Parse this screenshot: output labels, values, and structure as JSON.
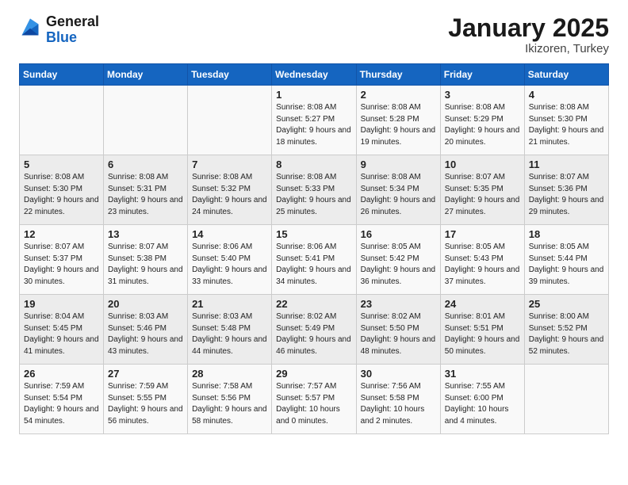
{
  "logo": {
    "general": "General",
    "blue": "Blue"
  },
  "title": "January 2025",
  "location": "Ikizoren, Turkey",
  "weekdays": [
    "Sunday",
    "Monday",
    "Tuesday",
    "Wednesday",
    "Thursday",
    "Friday",
    "Saturday"
  ],
  "weeks": [
    [
      {
        "day": "",
        "sunrise": "",
        "sunset": "",
        "daylight": ""
      },
      {
        "day": "",
        "sunrise": "",
        "sunset": "",
        "daylight": ""
      },
      {
        "day": "",
        "sunrise": "",
        "sunset": "",
        "daylight": ""
      },
      {
        "day": "1",
        "sunrise": "Sunrise: 8:08 AM",
        "sunset": "Sunset: 5:27 PM",
        "daylight": "Daylight: 9 hours and 18 minutes."
      },
      {
        "day": "2",
        "sunrise": "Sunrise: 8:08 AM",
        "sunset": "Sunset: 5:28 PM",
        "daylight": "Daylight: 9 hours and 19 minutes."
      },
      {
        "day": "3",
        "sunrise": "Sunrise: 8:08 AM",
        "sunset": "Sunset: 5:29 PM",
        "daylight": "Daylight: 9 hours and 20 minutes."
      },
      {
        "day": "4",
        "sunrise": "Sunrise: 8:08 AM",
        "sunset": "Sunset: 5:30 PM",
        "daylight": "Daylight: 9 hours and 21 minutes."
      }
    ],
    [
      {
        "day": "5",
        "sunrise": "Sunrise: 8:08 AM",
        "sunset": "Sunset: 5:30 PM",
        "daylight": "Daylight: 9 hours and 22 minutes."
      },
      {
        "day": "6",
        "sunrise": "Sunrise: 8:08 AM",
        "sunset": "Sunset: 5:31 PM",
        "daylight": "Daylight: 9 hours and 23 minutes."
      },
      {
        "day": "7",
        "sunrise": "Sunrise: 8:08 AM",
        "sunset": "Sunset: 5:32 PM",
        "daylight": "Daylight: 9 hours and 24 minutes."
      },
      {
        "day": "8",
        "sunrise": "Sunrise: 8:08 AM",
        "sunset": "Sunset: 5:33 PM",
        "daylight": "Daylight: 9 hours and 25 minutes."
      },
      {
        "day": "9",
        "sunrise": "Sunrise: 8:08 AM",
        "sunset": "Sunset: 5:34 PM",
        "daylight": "Daylight: 9 hours and 26 minutes."
      },
      {
        "day": "10",
        "sunrise": "Sunrise: 8:07 AM",
        "sunset": "Sunset: 5:35 PM",
        "daylight": "Daylight: 9 hours and 27 minutes."
      },
      {
        "day": "11",
        "sunrise": "Sunrise: 8:07 AM",
        "sunset": "Sunset: 5:36 PM",
        "daylight": "Daylight: 9 hours and 29 minutes."
      }
    ],
    [
      {
        "day": "12",
        "sunrise": "Sunrise: 8:07 AM",
        "sunset": "Sunset: 5:37 PM",
        "daylight": "Daylight: 9 hours and 30 minutes."
      },
      {
        "day": "13",
        "sunrise": "Sunrise: 8:07 AM",
        "sunset": "Sunset: 5:38 PM",
        "daylight": "Daylight: 9 hours and 31 minutes."
      },
      {
        "day": "14",
        "sunrise": "Sunrise: 8:06 AM",
        "sunset": "Sunset: 5:40 PM",
        "daylight": "Daylight: 9 hours and 33 minutes."
      },
      {
        "day": "15",
        "sunrise": "Sunrise: 8:06 AM",
        "sunset": "Sunset: 5:41 PM",
        "daylight": "Daylight: 9 hours and 34 minutes."
      },
      {
        "day": "16",
        "sunrise": "Sunrise: 8:05 AM",
        "sunset": "Sunset: 5:42 PM",
        "daylight": "Daylight: 9 hours and 36 minutes."
      },
      {
        "day": "17",
        "sunrise": "Sunrise: 8:05 AM",
        "sunset": "Sunset: 5:43 PM",
        "daylight": "Daylight: 9 hours and 37 minutes."
      },
      {
        "day": "18",
        "sunrise": "Sunrise: 8:05 AM",
        "sunset": "Sunset: 5:44 PM",
        "daylight": "Daylight: 9 hours and 39 minutes."
      }
    ],
    [
      {
        "day": "19",
        "sunrise": "Sunrise: 8:04 AM",
        "sunset": "Sunset: 5:45 PM",
        "daylight": "Daylight: 9 hours and 41 minutes."
      },
      {
        "day": "20",
        "sunrise": "Sunrise: 8:03 AM",
        "sunset": "Sunset: 5:46 PM",
        "daylight": "Daylight: 9 hours and 43 minutes."
      },
      {
        "day": "21",
        "sunrise": "Sunrise: 8:03 AM",
        "sunset": "Sunset: 5:48 PM",
        "daylight": "Daylight: 9 hours and 44 minutes."
      },
      {
        "day": "22",
        "sunrise": "Sunrise: 8:02 AM",
        "sunset": "Sunset: 5:49 PM",
        "daylight": "Daylight: 9 hours and 46 minutes."
      },
      {
        "day": "23",
        "sunrise": "Sunrise: 8:02 AM",
        "sunset": "Sunset: 5:50 PM",
        "daylight": "Daylight: 9 hours and 48 minutes."
      },
      {
        "day": "24",
        "sunrise": "Sunrise: 8:01 AM",
        "sunset": "Sunset: 5:51 PM",
        "daylight": "Daylight: 9 hours and 50 minutes."
      },
      {
        "day": "25",
        "sunrise": "Sunrise: 8:00 AM",
        "sunset": "Sunset: 5:52 PM",
        "daylight": "Daylight: 9 hours and 52 minutes."
      }
    ],
    [
      {
        "day": "26",
        "sunrise": "Sunrise: 7:59 AM",
        "sunset": "Sunset: 5:54 PM",
        "daylight": "Daylight: 9 hours and 54 minutes."
      },
      {
        "day": "27",
        "sunrise": "Sunrise: 7:59 AM",
        "sunset": "Sunset: 5:55 PM",
        "daylight": "Daylight: 9 hours and 56 minutes."
      },
      {
        "day": "28",
        "sunrise": "Sunrise: 7:58 AM",
        "sunset": "Sunset: 5:56 PM",
        "daylight": "Daylight: 9 hours and 58 minutes."
      },
      {
        "day": "29",
        "sunrise": "Sunrise: 7:57 AM",
        "sunset": "Sunset: 5:57 PM",
        "daylight": "Daylight: 10 hours and 0 minutes."
      },
      {
        "day": "30",
        "sunrise": "Sunrise: 7:56 AM",
        "sunset": "Sunset: 5:58 PM",
        "daylight": "Daylight: 10 hours and 2 minutes."
      },
      {
        "day": "31",
        "sunrise": "Sunrise: 7:55 AM",
        "sunset": "Sunset: 6:00 PM",
        "daylight": "Daylight: 10 hours and 4 minutes."
      },
      {
        "day": "",
        "sunrise": "",
        "sunset": "",
        "daylight": ""
      }
    ]
  ]
}
